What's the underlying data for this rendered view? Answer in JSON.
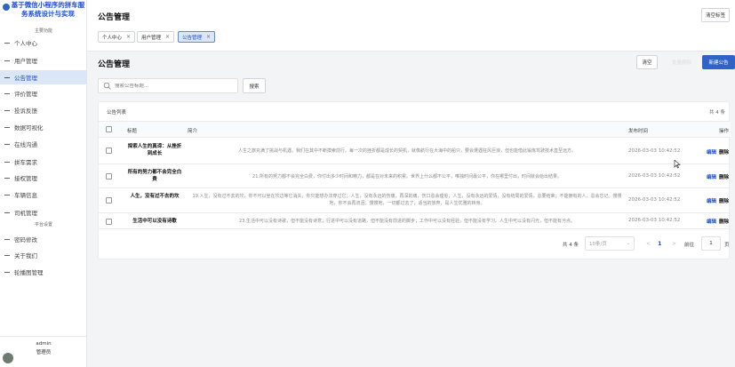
{
  "brand": {
    "title": "基于微信小程序的拼车服务系统设计与实现"
  },
  "sidebar": {
    "section_main": "主要功能",
    "section_platform": "平台设置",
    "items": [
      {
        "label": "个人中心"
      },
      {
        "label": "用户管理"
      },
      {
        "label": "公告管理"
      },
      {
        "label": "评价管理"
      },
      {
        "label": "投诉反馈"
      },
      {
        "label": "数据可视化"
      },
      {
        "label": "在线沟通"
      },
      {
        "label": "拼车需求"
      },
      {
        "label": "接权管理"
      },
      {
        "label": "车辆信息"
      },
      {
        "label": "司机管理"
      },
      {
        "label": "密码修改"
      },
      {
        "label": "关于我们"
      },
      {
        "label": "轮播图管理"
      }
    ],
    "user": {
      "name": "admin",
      "role": "管理员"
    }
  },
  "topbar": {
    "title": "公告管理",
    "clear_tabs": "清空标签",
    "tabs": [
      {
        "label": "个人中心",
        "close": "×"
      },
      {
        "label": "用户管理",
        "close": "×"
      },
      {
        "label": "公告管理",
        "close": "×"
      }
    ]
  },
  "page": {
    "title": "公告管理",
    "clear_btn": "清空",
    "ghost_btn": "批量删除",
    "new_btn": "新建公告",
    "search_placeholder": "搜索公告标题...",
    "search_btn": "搜索"
  },
  "table": {
    "card_title": "公告列表",
    "count": "共 4 条",
    "headers": {
      "title": "标题",
      "summary": "简介",
      "time": "发布时间",
      "actions": "操作"
    },
    "rows": [
      {
        "title": "探索人生的真谛：从挫折到成长",
        "summary": "人生之旅充满了挑战与机遇，我们在其中不断摸索前行。每一次的挫折都是成长的契机，就像航行在大海中的船只，要会遭遇狂风巨浪，但也能借此锻炼驾驶技术直至远方。",
        "time": "2026-03-03 10:42:52",
        "edit": "编辑",
        "del": "删除"
      },
      {
        "title": "所有的努力都不会完全白费",
        "summary": "21.所有的努力都不会完全白费，你付出多少时间和精力，都是在对未来的积累。世界上什么都不公平，唯独时间最公平，你在哪里付出，时间就会给出结果。",
        "time": "2026-03-03 10:42:52",
        "edit": "编辑",
        "del": "删除"
      },
      {
        "title": "人生，没有过不去的坎",
        "summary": "19.人生，没有过不去的坎，你不可以坐在坎边等它消失，你只能想办法穿过它；人生，没有永远的伤痛，再深的痛，伤口总会痊愈；人生，没有永远的爱情，没有结局的爱情，总要结束；不能拥有的人，总会忘记。慢慢地，你不会再流泪；慢慢地，一切都过去了，适当的放弃，是人生优雅的转身。",
        "time": "2026-03-03 10:42:52",
        "edit": "编辑",
        "del": "删除"
      },
      {
        "title": "生活中可以没有诗歌",
        "summary": "23.生活中可以没有诗歌，但不能没有诗意；行进中可以没有道路，但不能没有前进的脚步；工作中可以没有经验，但不能没有学习。人生中可以没有闪光，但不能有污点。",
        "time": "2026-03-03 10:42:52",
        "edit": "编辑",
        "del": "删除"
      }
    ]
  },
  "pagination": {
    "total": "共 4 条",
    "page_size": "10条/页",
    "prev": "<",
    "current": "1",
    "next": ">",
    "goto_label": "前往",
    "goto_value": "1",
    "page_unit": "页"
  }
}
